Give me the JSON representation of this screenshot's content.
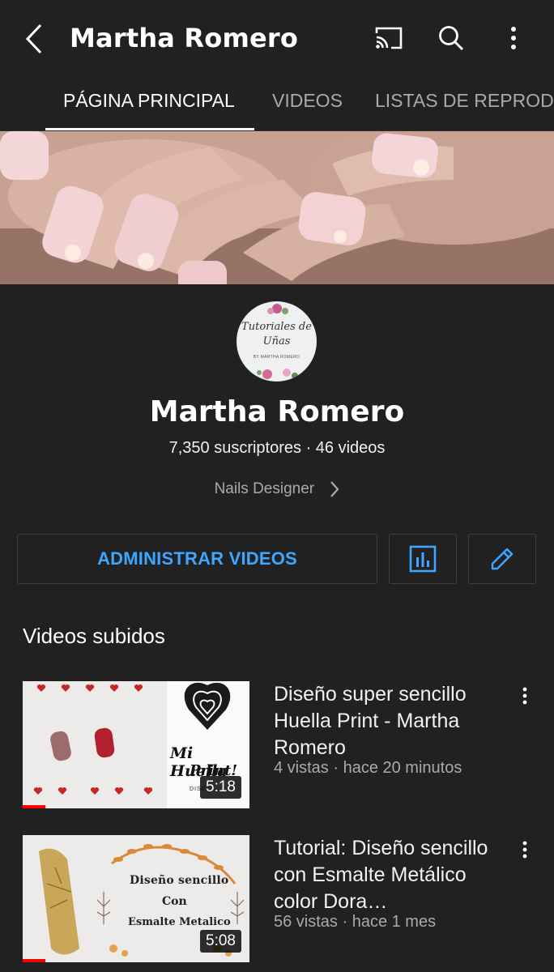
{
  "appbar": {
    "title": "Martha Romero",
    "icons": [
      "back-icon",
      "cast-icon",
      "search-icon",
      "more-vert-icon"
    ]
  },
  "tabs": [
    {
      "label": "PÁGINA PRINCIPAL",
      "active": true
    },
    {
      "label": "VIDEOS",
      "active": false
    },
    {
      "label": "LISTAS DE REPRODU",
      "active": false
    }
  ],
  "avatar": {
    "line1": "Tutoriales de",
    "line2": "Uñas",
    "line3": "BY MARTHA ROMERO"
  },
  "channel": {
    "name": "Martha Romero",
    "stats": "7,350 suscriptores · 46 videos",
    "link": "Nails Designer"
  },
  "actions": {
    "manage_label": "ADMINISTRAR VIDEOS",
    "analytics_icon": "analytics-icon",
    "edit_icon": "edit-icon",
    "accent": "#3ea6ff"
  },
  "section": {
    "title": "Videos subidos"
  },
  "videos": [
    {
      "title": "Diseño super sencillo Huella Print - Martha Romero",
      "meta": "4 vistas · hace 20 minutos",
      "duration": "5:18",
      "thumb_text1": "Mi Huella",
      "thumb_text2": "Print!",
      "thumb_text3": "DISE..."
    },
    {
      "title": "Tutorial: Diseño sencillo con Esmalte Metálico color Dora…",
      "meta": "56 vistas · hace 1 mes",
      "duration": "5:08",
      "thumb_text1": "Diseño sencillo",
      "thumb_text2": "Con",
      "thumb_text3": "Esmalte Metalico"
    }
  ]
}
